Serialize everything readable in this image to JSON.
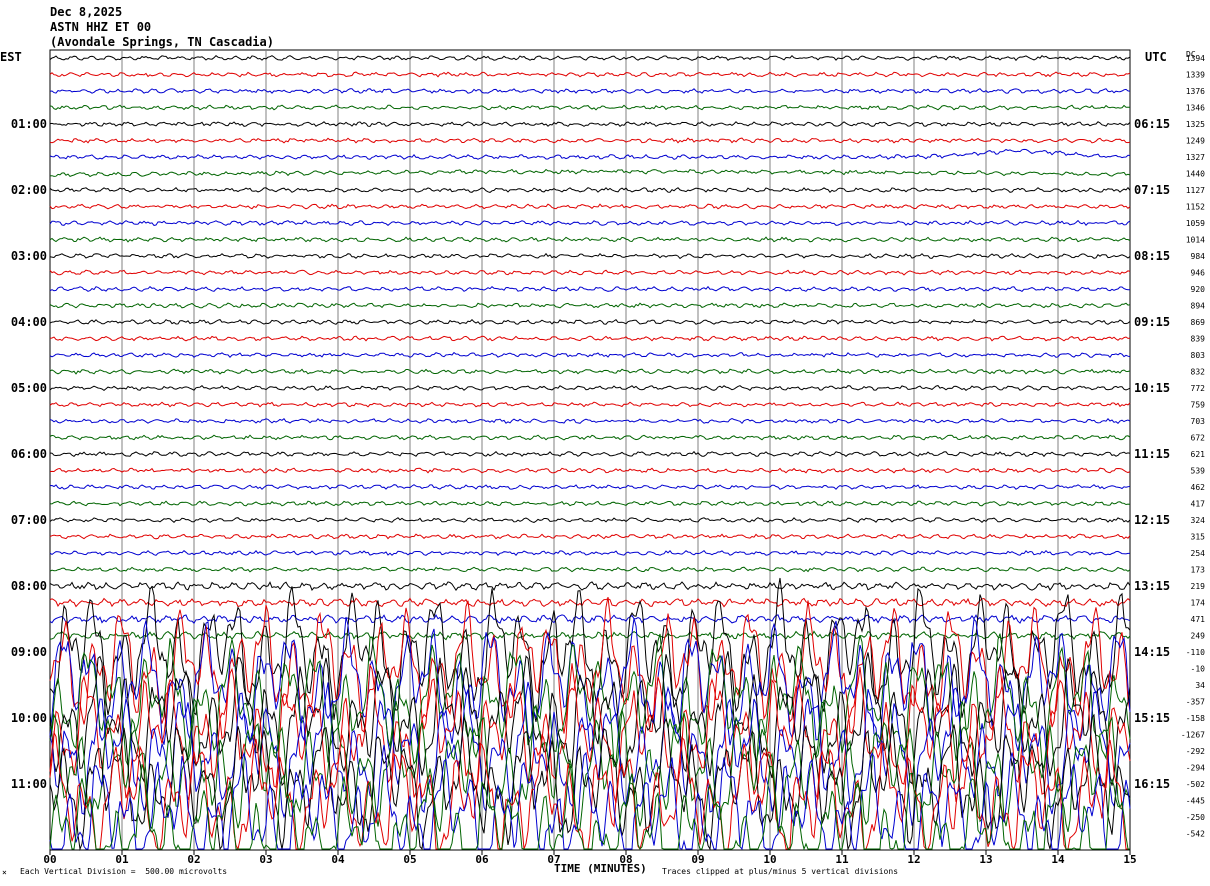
{
  "header": {
    "date": "Dec 8,2025",
    "station": "ASTN HHZ ET 00",
    "location": "(Avondale Springs, TN Cascadia)"
  },
  "left_label": "EST",
  "right_label": "UTC",
  "dc_label": "DC",
  "footer": {
    "division_note": "Each Vertical Division =  500.00 microvolts",
    "clip_note": "Traces clipped at plus/minus 5 vertical divisions",
    "marker": "×"
  },
  "chart_data": {
    "type": "line",
    "title": "ASTN HHZ ET 00",
    "xlabel": "TIME (MINUTES)",
    "ylabel": "",
    "x_ticks": [
      "00",
      "01",
      "02",
      "03",
      "04",
      "05",
      "06",
      "07",
      "08",
      "09",
      "10",
      "11",
      "12",
      "13",
      "14",
      "15"
    ],
    "xlim": [
      0,
      15
    ],
    "grid": true,
    "trace_colors": [
      "#000000",
      "#e00000",
      "#0000d0",
      "#006400"
    ],
    "est_hours": [
      "01:00",
      "02:00",
      "03:00",
      "04:00",
      "05:00",
      "06:00",
      "07:00",
      "08:00",
      "09:00",
      "10:00",
      "11:00"
    ],
    "utc_hours": [
      "06:15",
      "07:15",
      "08:15",
      "09:15",
      "10:15",
      "11:15",
      "12:15",
      "13:15",
      "14:15",
      "15:15",
      "16:15"
    ],
    "trace_dc_offsets": [
      1394,
      1339,
      1376,
      1346,
      1325,
      1249,
      1327,
      1440,
      1127,
      1152,
      1059,
      1014,
      984,
      946,
      920,
      894,
      869,
      839,
      803,
      832,
      772,
      759,
      703,
      672,
      621,
      539,
      462,
      417,
      324,
      315,
      254,
      173,
      219,
      174,
      471,
      249,
      -110,
      -10,
      34,
      -357,
      -158,
      -1267,
      -292,
      -294,
      -502,
      -445,
      -250,
      -542
    ]
  }
}
